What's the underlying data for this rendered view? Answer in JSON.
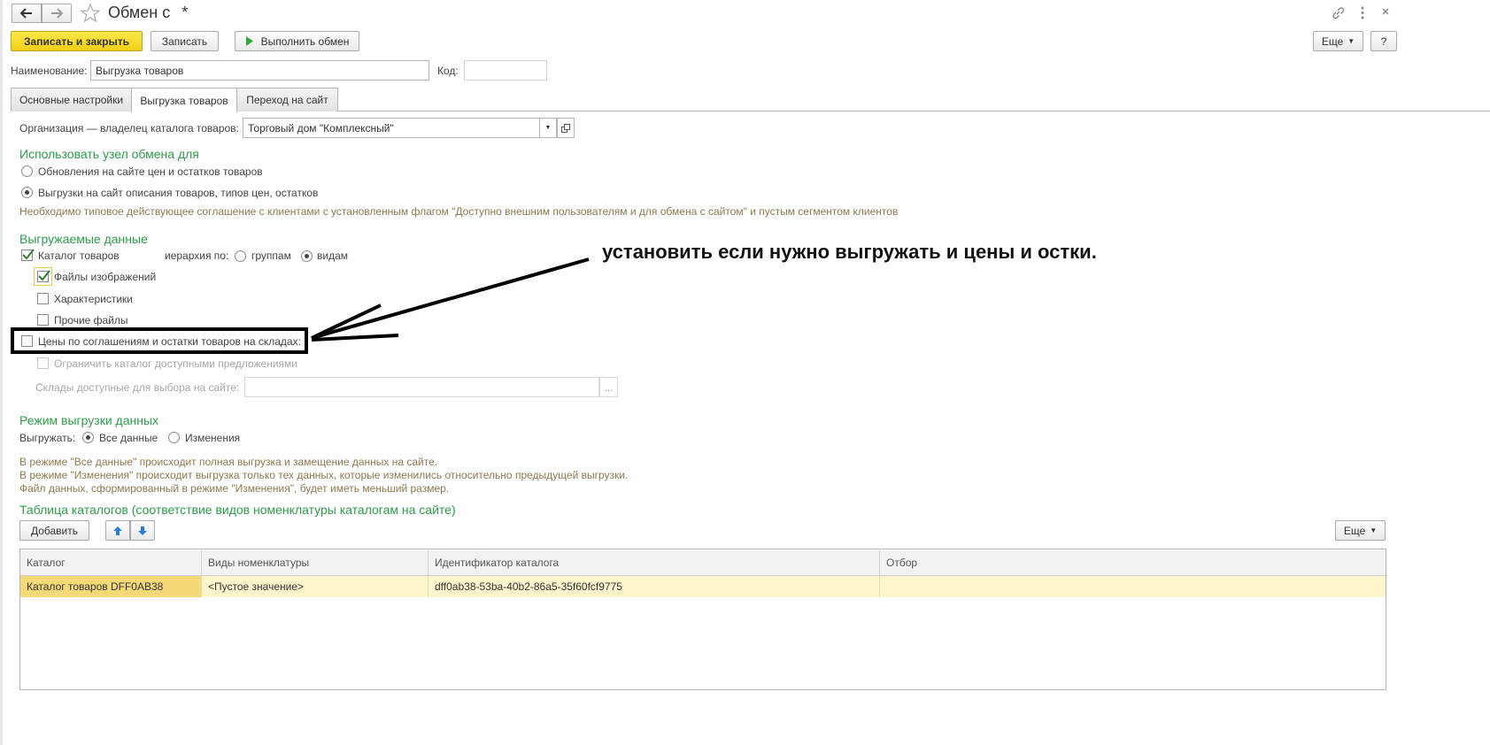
{
  "window": {
    "title": "Обмен с",
    "modified_mark": "*",
    "more_label": "Еще",
    "help_label": "?"
  },
  "toolbar": {
    "save_close_label": "Записать и закрыть",
    "save_label": "Записать",
    "exchange_label": "Выполнить обмен"
  },
  "fields": {
    "name_label": "Наименование:",
    "name_value": "Выгрузка товаров",
    "code_label": "Код:",
    "code_value": ""
  },
  "tabs": [
    {
      "label": "Основные настройки",
      "active": false
    },
    {
      "label": "Выгрузка товаров",
      "active": true
    },
    {
      "label": "Переход на сайт",
      "active": false
    }
  ],
  "org": {
    "label": "Организация — владелец каталога товаров:",
    "value": "Торговый дом \"Комплексный\""
  },
  "use_node": {
    "title": "Использовать узел обмена для",
    "option1": "Обновления на сайте цен и остатков товаров",
    "option2": "Выгрузки на сайт описания товаров, типов цен, остатков",
    "selected": 2,
    "note": "Необходимо типовое действующее соглашение с клиентами с установленным флагом \"Доступно внешним пользователям и для обмена с сайтом\" и пустым сегментом клиентов"
  },
  "export_data": {
    "title": "Выгружаемые данные",
    "catalog_label": "Каталог товаров",
    "hierarchy_label": "иерархия по:",
    "groups_label": "группам",
    "kinds_label": "видам",
    "images_label": "Файлы изображений",
    "characteristics_label": "Характеристики",
    "other_files_label": "Прочие файлы",
    "prices_label": "Цены по соглашениям и остатки товаров на складах:",
    "limit_label": "Ограничить каталог доступными предложениями",
    "warehouses_label": "Склады доступные для выбора на сайте:",
    "warehouses_value": "",
    "ellipsis": "..."
  },
  "annotation": {
    "text": "установить если нужно выгружать и цены и остки."
  },
  "mode": {
    "title": "Режим выгрузки данных",
    "label": "Выгружать:",
    "all_label": "Все данные",
    "changes_label": "Изменения",
    "note1": "В режиме \"Все данные\" происходит полная выгрузка  и замещение данных на сайте.",
    "note2": "В режиме \"Изменения\" происходит выгрузка только тех данных, которые изменились относительно предыдущей выгрузки.",
    "note3": "Файл данных, сформированный в режиме \"Изменения\", будет иметь меньший размер."
  },
  "catalogs": {
    "title": "Таблица каталогов (соответствие видов номенклатуры каталогам на сайте)",
    "add_label": "Добавить",
    "more_label": "Еще",
    "columns": [
      "Каталог",
      "Виды номенклатуры",
      "Идентификатор каталога",
      "Отбор"
    ],
    "rows": [
      [
        "Каталог товаров DFF0AB38",
        "<Пустое значение>",
        "dff0ab38-53ba-40b2-86a5-35f60fcf9775",
        ""
      ]
    ]
  }
}
